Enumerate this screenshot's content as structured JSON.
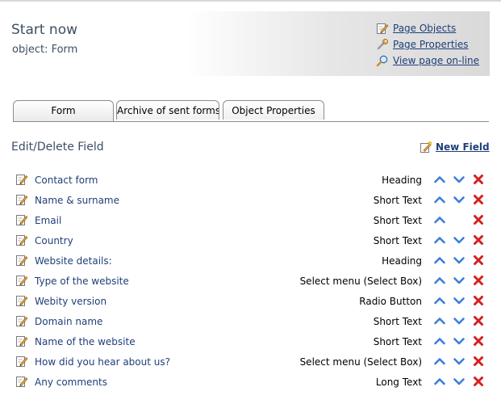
{
  "header": {
    "title": "Start now",
    "subtitle": "object: Form",
    "links": [
      {
        "label": "Page Objects",
        "icon": "pencil-page-icon"
      },
      {
        "label": "Page Properties",
        "icon": "wrench-icon"
      },
      {
        "label": "View page on-line",
        "icon": "magnifier-icon"
      }
    ]
  },
  "tabs": [
    {
      "label": "Form",
      "active": true
    },
    {
      "label": "Archive of sent forms",
      "active": false
    },
    {
      "label": "Object Properties",
      "active": false
    }
  ],
  "section": {
    "title": "Edit/Delete Field",
    "new_field_label": "New Field"
  },
  "fields": [
    {
      "name": "Contact form",
      "type": "Heading",
      "up": true,
      "down": true
    },
    {
      "name": "Name & surname",
      "type": "Short Text",
      "up": true,
      "down": true
    },
    {
      "name": "Email",
      "type": "Short Text",
      "up": true,
      "down": false
    },
    {
      "name": "Country",
      "type": "Short Text",
      "up": true,
      "down": true
    },
    {
      "name": "Website details:",
      "type": "Heading",
      "up": true,
      "down": true
    },
    {
      "name": "Type of the website",
      "type": "Select menu (Select Box)",
      "up": true,
      "down": true
    },
    {
      "name": "Webity version",
      "type": "Radio Button",
      "up": true,
      "down": true
    },
    {
      "name": "Domain name",
      "type": "Short Text",
      "up": true,
      "down": true
    },
    {
      "name": "Name of the website",
      "type": "Short Text",
      "up": true,
      "down": true
    },
    {
      "name": "How did you hear about us?",
      "type": "Select menu (Select Box)",
      "up": true,
      "down": true
    },
    {
      "name": "Any comments",
      "type": "Long Text",
      "up": true,
      "down": true
    }
  ],
  "colors": {
    "link": "#1f3f78",
    "heading": "#3c4f63",
    "arrow": "#3b7fd6",
    "delete": "#d42020"
  }
}
